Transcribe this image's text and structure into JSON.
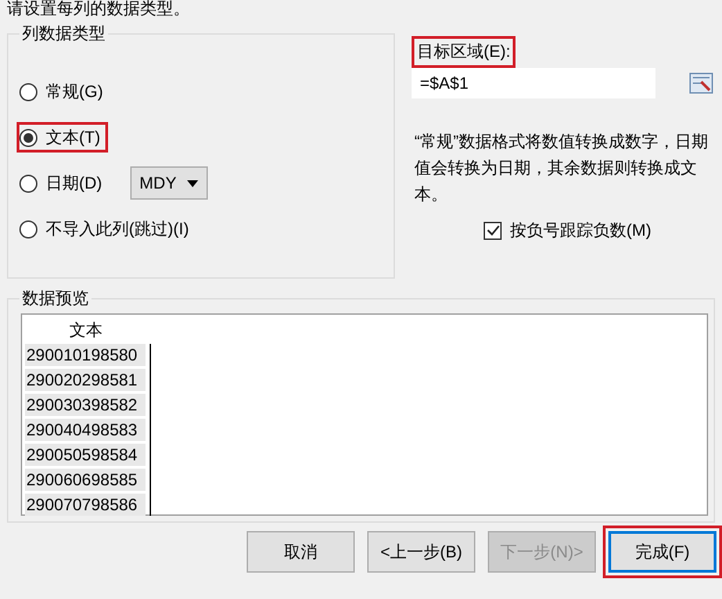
{
  "instruction": "请设置每列的数据类型。",
  "column_type": {
    "title": "列数据类型",
    "options": [
      {
        "label": "常规(G)",
        "selected": false,
        "highlighted": false
      },
      {
        "label": "文本(T)",
        "selected": true,
        "highlighted": true
      },
      {
        "label": "日期(D)",
        "selected": false,
        "highlighted": false,
        "date_format": "MDY"
      },
      {
        "label": "不导入此列(跳过)(I)",
        "selected": false,
        "highlighted": false
      }
    ]
  },
  "destination": {
    "label": "目标区域(E):",
    "value": "=$A$1",
    "highlighted": true
  },
  "description": "“常规”数据格式将数值转换成数字，日期值会转换为日期，其余数据则转换成文本。",
  "negative_check": {
    "label": "按负号跟踪负数(M)",
    "checked": true
  },
  "preview": {
    "title": "数据预览",
    "column_header": "文本",
    "rows": [
      "290010198580",
      "290020298581",
      "290030398582",
      "290040498583",
      "290050598584",
      "290060698585",
      "290070798586"
    ]
  },
  "buttons": [
    {
      "label": "取消",
      "disabled": false,
      "default": false,
      "highlighted": false
    },
    {
      "label": "<上一步(B)",
      "disabled": false,
      "default": false,
      "highlighted": false
    },
    {
      "label": "下一步(N)>",
      "disabled": true,
      "default": false,
      "highlighted": false
    },
    {
      "label": "完成(F)",
      "disabled": false,
      "default": true,
      "highlighted": true
    }
  ]
}
